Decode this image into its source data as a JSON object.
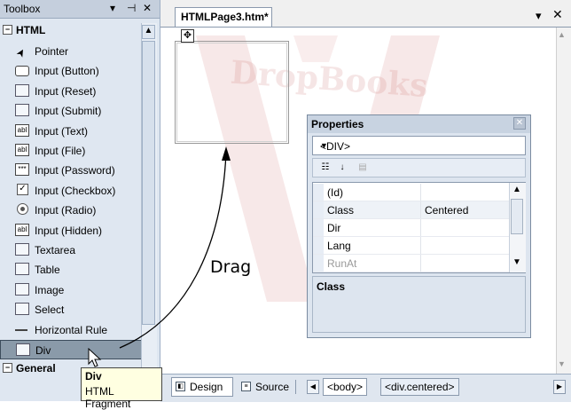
{
  "toolbox": {
    "title": "Toolbox",
    "controls": [
      "▾",
      "⊣",
      "✕"
    ],
    "html_group": "HTML",
    "general_group": "General",
    "items": [
      {
        "label": "Pointer",
        "icon": "pointer-icon"
      },
      {
        "label": "Input (Button)",
        "icon": "button-icon"
      },
      {
        "label": "Input (Reset)",
        "icon": "reset-icon"
      },
      {
        "label": "Input (Submit)",
        "icon": "submit-icon"
      },
      {
        "label": "Input (Text)",
        "icon": "textbox-icon",
        "glyph": "abl"
      },
      {
        "label": "Input (File)",
        "icon": "file-input-icon",
        "glyph": "abl"
      },
      {
        "label": "Input (Password)",
        "icon": "password-icon",
        "glyph": "***"
      },
      {
        "label": "Input (Checkbox)",
        "icon": "checkbox-icon",
        "glyph": "✓"
      },
      {
        "label": "Input (Radio)",
        "icon": "radio-icon"
      },
      {
        "label": "Input (Hidden)",
        "icon": "hidden-input-icon",
        "glyph": "abl"
      },
      {
        "label": "Textarea",
        "icon": "textarea-icon"
      },
      {
        "label": "Table",
        "icon": "table-icon"
      },
      {
        "label": "Image",
        "icon": "image-icon"
      },
      {
        "label": "Select",
        "icon": "select-icon"
      },
      {
        "label": "Horizontal Rule",
        "icon": "horizontal-rule-icon"
      },
      {
        "label": "Div",
        "icon": "div-icon"
      }
    ],
    "tooltip": {
      "title": "Div",
      "subtitle": "HTML Fragment"
    }
  },
  "document": {
    "tab_label": "HTMLPage3.htm*",
    "controls": [
      "▾",
      "✕"
    ]
  },
  "watermark": "DropBooks",
  "annotation": {
    "drag_label": "Drag"
  },
  "properties": {
    "title": "Properties",
    "selected_object": "<DIV>",
    "rows": [
      {
        "name": "(Id)",
        "value": ""
      },
      {
        "name": "Class",
        "value": "Centered"
      },
      {
        "name": "Dir",
        "value": ""
      },
      {
        "name": "Lang",
        "value": ""
      },
      {
        "name": "RunAt",
        "value": ""
      }
    ],
    "description_title": "Class"
  },
  "bottom": {
    "design_label": "Design",
    "source_label": "Source",
    "breadcrumbs": [
      "<body>",
      "<div.centered>"
    ]
  },
  "colors": {
    "toolbox_bg": "#dfe7f1",
    "selected_item": "#8a9aa9",
    "tooltip_bg": "#ffffe1",
    "watermark": "#c0504d"
  }
}
